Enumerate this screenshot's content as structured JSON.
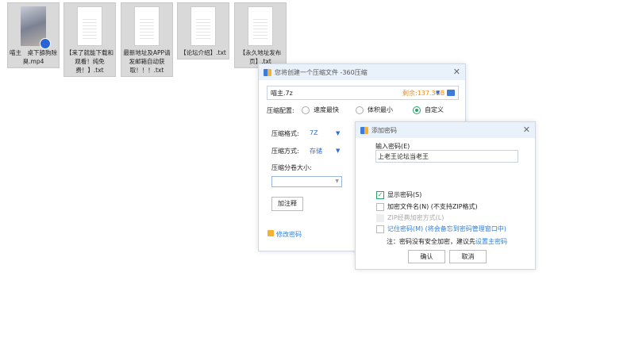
{
  "desktop": {
    "files": [
      {
        "name": "喵主　桌下舔狗除臭.mp4",
        "type": "video"
      },
      {
        "name": "【来了就能下载和观看！纯免费！】.txt",
        "type": "text"
      },
      {
        "name": "最新地址及APP请发邮箱自动获取！！！.txt",
        "type": "text"
      },
      {
        "name": "【论坛介绍】.txt",
        "type": "text"
      },
      {
        "name": "【永久地址发布页】.txt",
        "type": "text"
      }
    ]
  },
  "compress_dialog": {
    "title": "您将创建一个压缩文件 -360压缩",
    "filename": "喵主.7z",
    "free_space": "剩余:137.3GB",
    "config_label": "压缩配置:",
    "options": [
      "速度最快",
      "体积最小",
      "自定义"
    ],
    "selected_option": "自定义",
    "format_label": "压缩格式:",
    "format_value": "7Z",
    "method_label": "压缩方式:",
    "method_value": "存储",
    "split_label": "压缩分卷大小:",
    "split_value": "",
    "comment_button": "加注释",
    "change_password": "修改密码"
  },
  "password_dialog": {
    "title": "添加密码",
    "input_label": "输入密码(E)",
    "password": "上老王论坛当老王",
    "checkboxes": [
      {
        "label": "显示密码(S)",
        "checked": true,
        "disabled": false
      },
      {
        "label": "加密文件名(N) (不支持ZIP格式)",
        "checked": false,
        "disabled": false
      },
      {
        "label": "ZIP经典加密方式(L)",
        "checked": false,
        "disabled": true
      },
      {
        "label": "记住密码(M) (将会备忘到密码管理窗口中)",
        "checked": false,
        "disabled": false
      }
    ],
    "note": "注：密码没有安全加密，建议先",
    "note_link": "设置主密码",
    "ok": "确认",
    "cancel": "取消"
  }
}
